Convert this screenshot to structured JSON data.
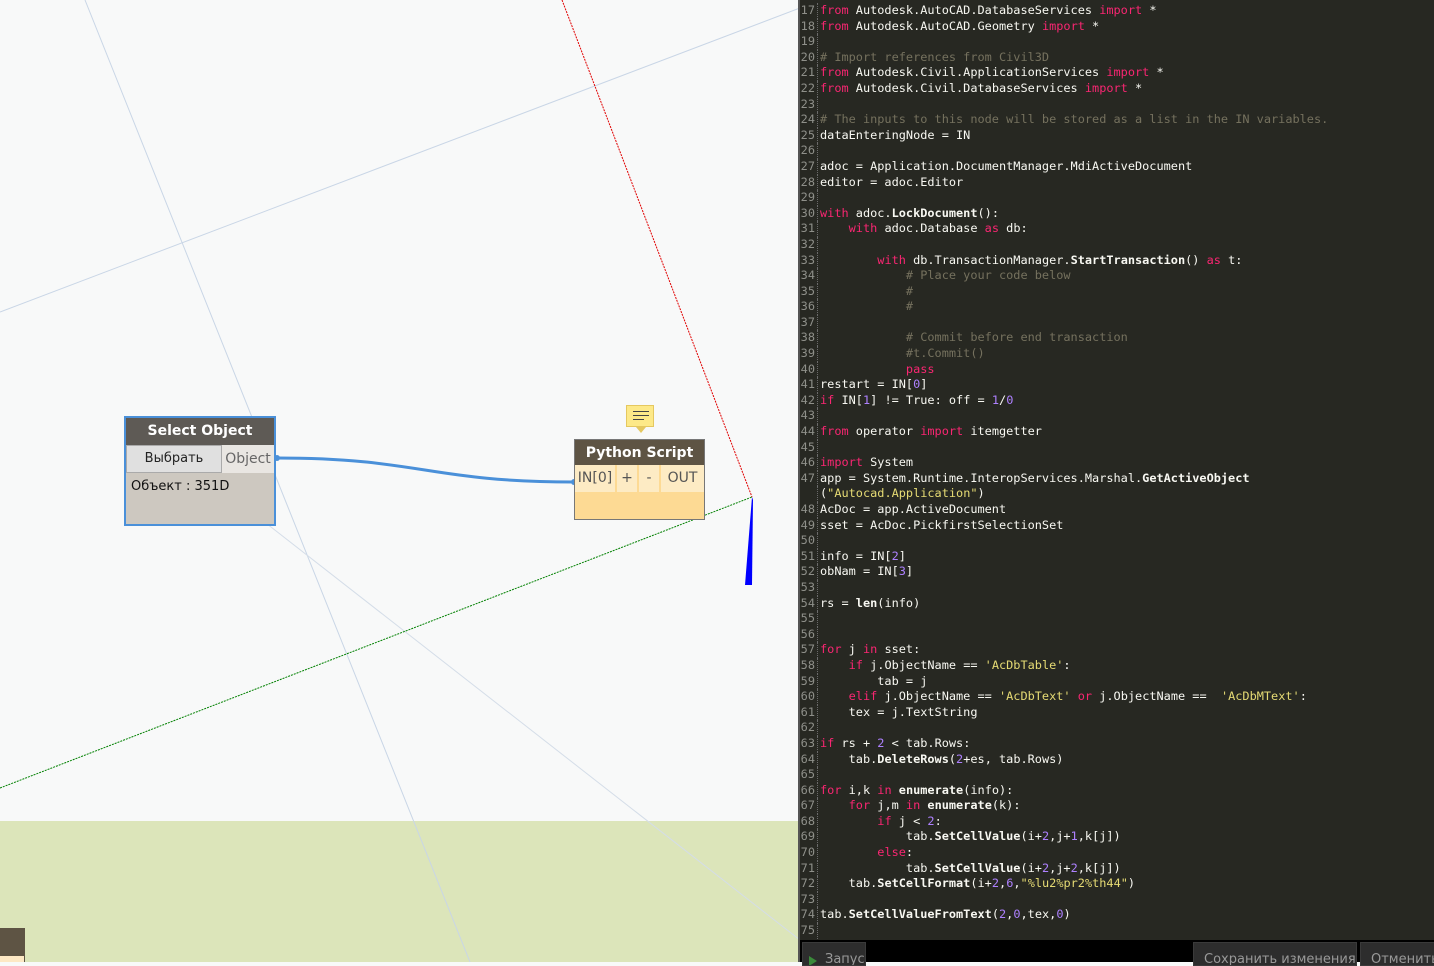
{
  "canvas": {
    "select_node": {
      "title": "Select Object",
      "button": "Выбрать",
      "output_port": "Object",
      "value": "Объект : 351D"
    },
    "python_node": {
      "title": "Python Script",
      "input_port": "IN[0]",
      "add": "+",
      "remove": "-",
      "output_port": "OUT"
    },
    "colors": {
      "background": "#f8f9f9",
      "ground": "#dce5ba",
      "wire": "#4a90d9",
      "x_axis": "#e00000",
      "y_axis": "#008000",
      "z_axis": "#0000ff"
    }
  },
  "editor": {
    "lines": [
      {
        "n": "17",
        "tokens": [
          [
            "k",
            "from"
          ],
          [
            "t",
            " Autodesk.AutoCAD.DatabaseServices "
          ],
          [
            "k",
            "import"
          ],
          [
            "t",
            " *"
          ]
        ]
      },
      {
        "n": "18",
        "tokens": [
          [
            "k",
            "from"
          ],
          [
            "t",
            " Autodesk.AutoCAD.Geometry "
          ],
          [
            "k",
            "import"
          ],
          [
            "t",
            " *"
          ]
        ]
      },
      {
        "n": "19",
        "tokens": []
      },
      {
        "n": "20",
        "tokens": [
          [
            "c",
            "# Import references from Civil3D"
          ]
        ]
      },
      {
        "n": "21",
        "tokens": [
          [
            "k",
            "from"
          ],
          [
            "t",
            " Autodesk.Civil.ApplicationServices "
          ],
          [
            "k",
            "import"
          ],
          [
            "t",
            " *"
          ]
        ]
      },
      {
        "n": "22",
        "tokens": [
          [
            "k",
            "from"
          ],
          [
            "t",
            " Autodesk.Civil.DatabaseServices "
          ],
          [
            "k",
            "import"
          ],
          [
            "t",
            " *"
          ]
        ]
      },
      {
        "n": "23",
        "tokens": []
      },
      {
        "n": "24",
        "tokens": [
          [
            "c",
            "# The inputs to this node will be stored as a list in the IN variables."
          ]
        ]
      },
      {
        "n": "25",
        "tokens": [
          [
            "t",
            "dataEnteringNode = IN"
          ]
        ]
      },
      {
        "n": "26",
        "tokens": []
      },
      {
        "n": "27",
        "tokens": [
          [
            "t",
            "adoc = Application.DocumentManager.MdiActiveDocument"
          ]
        ]
      },
      {
        "n": "28",
        "tokens": [
          [
            "t",
            "editor = adoc.Editor"
          ]
        ]
      },
      {
        "n": "29",
        "tokens": []
      },
      {
        "n": "30",
        "tokens": [
          [
            "k",
            "with"
          ],
          [
            "t",
            " adoc."
          ],
          [
            "b",
            "LockDocument"
          ],
          [
            "t",
            "():"
          ]
        ]
      },
      {
        "n": "31",
        "tokens": [
          [
            "t",
            "    "
          ],
          [
            "k",
            "with"
          ],
          [
            "t",
            " adoc.Database "
          ],
          [
            "k",
            "as"
          ],
          [
            "t",
            " db:"
          ]
        ]
      },
      {
        "n": "32",
        "tokens": []
      },
      {
        "n": "33",
        "tokens": [
          [
            "t",
            "        "
          ],
          [
            "k",
            "with"
          ],
          [
            "t",
            " db.TransactionManager."
          ],
          [
            "b",
            "StartTransaction"
          ],
          [
            "t",
            "() "
          ],
          [
            "k",
            "as"
          ],
          [
            "t",
            " t:"
          ]
        ]
      },
      {
        "n": "34",
        "tokens": [
          [
            "t",
            "            "
          ],
          [
            "c",
            "# Place your code below"
          ]
        ]
      },
      {
        "n": "35",
        "tokens": [
          [
            "t",
            "            "
          ],
          [
            "c",
            "#"
          ]
        ]
      },
      {
        "n": "36",
        "tokens": [
          [
            "t",
            "            "
          ],
          [
            "c",
            "#"
          ]
        ]
      },
      {
        "n": "37",
        "tokens": []
      },
      {
        "n": "38",
        "tokens": [
          [
            "t",
            "            "
          ],
          [
            "c",
            "# Commit before end transaction"
          ]
        ]
      },
      {
        "n": "39",
        "tokens": [
          [
            "t",
            "            "
          ],
          [
            "c",
            "#t.Commit()"
          ]
        ]
      },
      {
        "n": "40",
        "tokens": [
          [
            "t",
            "            "
          ],
          [
            "k",
            "pass"
          ]
        ]
      },
      {
        "n": "41",
        "tokens": [
          [
            "t",
            "restart = IN["
          ],
          [
            "n",
            "0"
          ],
          [
            "t",
            "]"
          ]
        ]
      },
      {
        "n": "42",
        "tokens": [
          [
            "k",
            "if"
          ],
          [
            "t",
            " IN["
          ],
          [
            "n",
            "1"
          ],
          [
            "t",
            "] != True: off = "
          ],
          [
            "n",
            "1"
          ],
          [
            "t",
            "/"
          ],
          [
            "n",
            "0"
          ]
        ]
      },
      {
        "n": "43",
        "tokens": []
      },
      {
        "n": "44",
        "tokens": [
          [
            "k",
            "from"
          ],
          [
            "t",
            " operator "
          ],
          [
            "k",
            "import"
          ],
          [
            "t",
            " itemgetter"
          ]
        ]
      },
      {
        "n": "45",
        "tokens": []
      },
      {
        "n": "46",
        "tokens": [
          [
            "k",
            "import"
          ],
          [
            "t",
            " System"
          ]
        ]
      },
      {
        "n": "47",
        "tokens": [
          [
            "t",
            "app = System.Runtime.InteropServices.Marshal."
          ],
          [
            "b",
            "GetActiveObject"
          ]
        ]
      },
      {
        "n": "",
        "tokens": [
          [
            "t",
            "("
          ],
          [
            "s",
            "\"Autocad.Application\""
          ],
          [
            "t",
            ")"
          ]
        ]
      },
      {
        "n": "48",
        "tokens": [
          [
            "t",
            "AcDoc = app.ActiveDocument"
          ]
        ]
      },
      {
        "n": "49",
        "tokens": [
          [
            "t",
            "sset = AcDoc.PickfirstSelectionSet"
          ]
        ]
      },
      {
        "n": "50",
        "tokens": []
      },
      {
        "n": "51",
        "tokens": [
          [
            "t",
            "info = IN["
          ],
          [
            "n",
            "2"
          ],
          [
            "t",
            "]"
          ]
        ]
      },
      {
        "n": "52",
        "tokens": [
          [
            "t",
            "obNam = IN["
          ],
          [
            "n",
            "3"
          ],
          [
            "t",
            "]"
          ]
        ]
      },
      {
        "n": "53",
        "tokens": []
      },
      {
        "n": "54",
        "tokens": [
          [
            "t",
            "rs = "
          ],
          [
            "b",
            "len"
          ],
          [
            "t",
            "(info)"
          ]
        ]
      },
      {
        "n": "55",
        "tokens": []
      },
      {
        "n": "56",
        "tokens": []
      },
      {
        "n": "57",
        "tokens": [
          [
            "k",
            "for"
          ],
          [
            "t",
            " j "
          ],
          [
            "k",
            "in"
          ],
          [
            "t",
            " sset:"
          ]
        ]
      },
      {
        "n": "58",
        "tokens": [
          [
            "t",
            "    "
          ],
          [
            "k",
            "if"
          ],
          [
            "t",
            " j.ObjectName == "
          ],
          [
            "s",
            "'AcDbTable'"
          ],
          [
            "t",
            ":"
          ]
        ]
      },
      {
        "n": "59",
        "tokens": [
          [
            "t",
            "        tab = j"
          ]
        ]
      },
      {
        "n": "60",
        "tokens": [
          [
            "t",
            "    "
          ],
          [
            "k",
            "elif"
          ],
          [
            "t",
            " j.ObjectName == "
          ],
          [
            "s",
            "'AcDbText'"
          ],
          [
            "t",
            " "
          ],
          [
            "k",
            "or"
          ],
          [
            "t",
            " j.ObjectName ==  "
          ],
          [
            "s",
            "'AcDbMText'"
          ],
          [
            "t",
            ":"
          ]
        ]
      },
      {
        "n": "61",
        "tokens": [
          [
            "t",
            "    tex = j.TextString"
          ]
        ]
      },
      {
        "n": "62",
        "tokens": []
      },
      {
        "n": "63",
        "tokens": [
          [
            "k",
            "if"
          ],
          [
            "t",
            " rs + "
          ],
          [
            "n",
            "2"
          ],
          [
            "t",
            " < tab.Rows:"
          ]
        ]
      },
      {
        "n": "64",
        "tokens": [
          [
            "t",
            "    tab."
          ],
          [
            "b",
            "DeleteRows"
          ],
          [
            "t",
            "("
          ],
          [
            "n",
            "2"
          ],
          [
            "t",
            "+es, tab.Rows)"
          ]
        ]
      },
      {
        "n": "65",
        "tokens": []
      },
      {
        "n": "66",
        "tokens": [
          [
            "k",
            "for"
          ],
          [
            "t",
            " i,k "
          ],
          [
            "k",
            "in"
          ],
          [
            "t",
            " "
          ],
          [
            "b",
            "enumerate"
          ],
          [
            "t",
            "(info):"
          ]
        ]
      },
      {
        "n": "67",
        "tokens": [
          [
            "t",
            "    "
          ],
          [
            "k",
            "for"
          ],
          [
            "t",
            " j,m "
          ],
          [
            "k",
            "in"
          ],
          [
            "t",
            " "
          ],
          [
            "b",
            "enumerate"
          ],
          [
            "t",
            "(k):"
          ]
        ]
      },
      {
        "n": "68",
        "tokens": [
          [
            "t",
            "        "
          ],
          [
            "k",
            "if"
          ],
          [
            "t",
            " j < "
          ],
          [
            "n",
            "2"
          ],
          [
            "t",
            ":"
          ]
        ]
      },
      {
        "n": "69",
        "tokens": [
          [
            "t",
            "            tab."
          ],
          [
            "b",
            "SetCellValue"
          ],
          [
            "t",
            "(i+"
          ],
          [
            "n",
            "2"
          ],
          [
            "t",
            ",j+"
          ],
          [
            "n",
            "1"
          ],
          [
            "t",
            ",k[j])"
          ]
        ]
      },
      {
        "n": "70",
        "tokens": [
          [
            "t",
            "        "
          ],
          [
            "k",
            "else"
          ],
          [
            "t",
            ":"
          ]
        ]
      },
      {
        "n": "71",
        "tokens": [
          [
            "t",
            "            tab."
          ],
          [
            "b",
            "SetCellValue"
          ],
          [
            "t",
            "(i+"
          ],
          [
            "n",
            "2"
          ],
          [
            "t",
            ",j+"
          ],
          [
            "n",
            "2"
          ],
          [
            "t",
            ",k[j])"
          ]
        ]
      },
      {
        "n": "72",
        "tokens": [
          [
            "t",
            "    tab."
          ],
          [
            "b",
            "SetCellFormat"
          ],
          [
            "t",
            "(i+"
          ],
          [
            "n",
            "2"
          ],
          [
            "t",
            ","
          ],
          [
            "n",
            "6"
          ],
          [
            "t",
            ","
          ],
          [
            "s",
            "\"%lu2%pr2%th44\""
          ],
          [
            "t",
            ")"
          ]
        ]
      },
      {
        "n": "73",
        "tokens": []
      },
      {
        "n": "74",
        "tokens": [
          [
            "t",
            "tab."
          ],
          [
            "b",
            "SetCellValueFromText"
          ],
          [
            "t",
            "("
          ],
          [
            "n",
            "2"
          ],
          [
            "t",
            ","
          ],
          [
            "n",
            "0"
          ],
          [
            "t",
            ",tex,"
          ],
          [
            "n",
            "0"
          ],
          [
            "t",
            ")"
          ]
        ]
      },
      {
        "n": "75",
        "tokens": []
      }
    ],
    "colors": {
      "background": "#272822",
      "keyword": "#f92672",
      "comment": "#75715e",
      "string": "#e6db74",
      "number": "#ae81ff",
      "text": "#f8f8f2"
    }
  },
  "footer": {
    "run": "Запуск",
    "save": "Сохранить изменения",
    "cancel": "Отменить"
  }
}
